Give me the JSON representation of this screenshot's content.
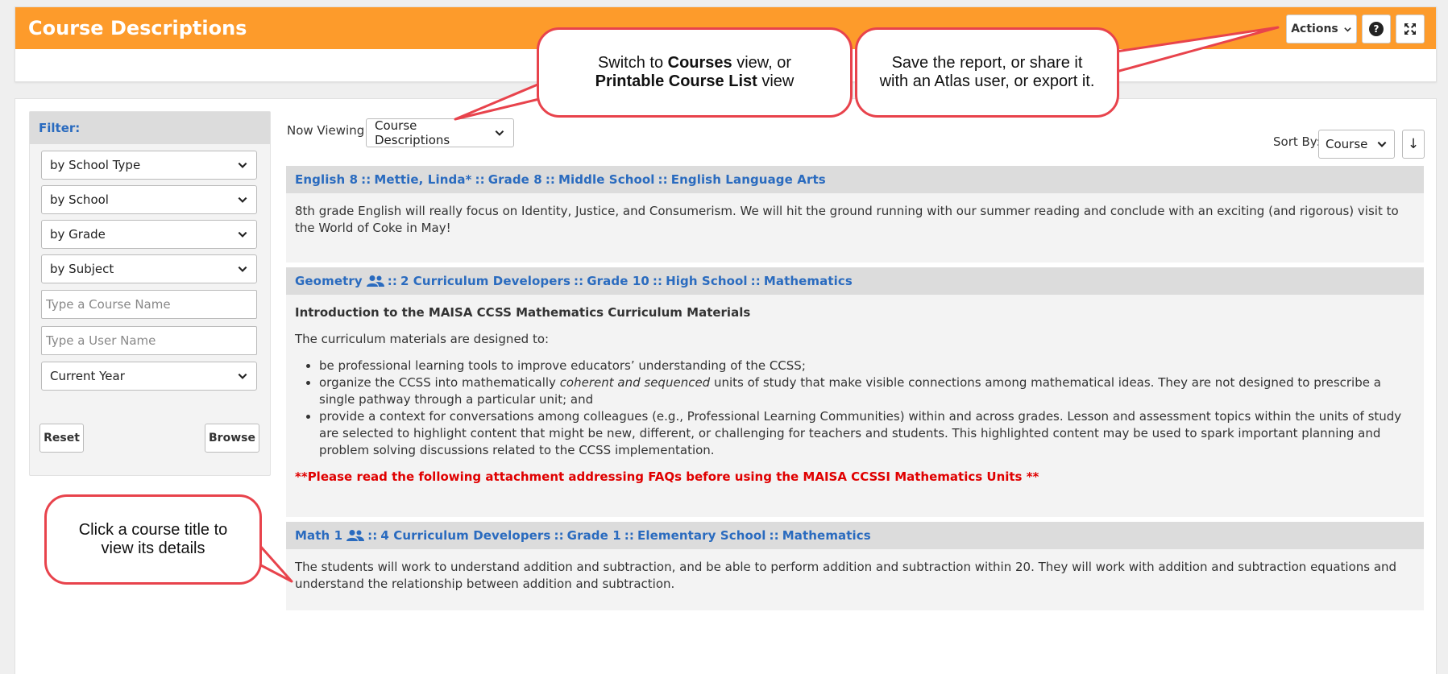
{
  "header": {
    "title": "Course Descriptions",
    "actions_label": "Actions",
    "help_icon": "question-circle-icon",
    "fullscreen_icon": "expand-icon",
    "brand_color": "#fd9b2b"
  },
  "filter": {
    "title": "Filter:",
    "school_type": "by School Type",
    "school": "by School",
    "grade": "by Grade",
    "subject": "by Subject",
    "course_placeholder": "Type a Course Name",
    "user_placeholder": "Type a User Name",
    "year": "Current Year",
    "reset_label": "Reset",
    "browse_label": "Browse"
  },
  "view": {
    "label": "Now Viewing:",
    "selected": "Course Descriptions",
    "sort_label": "Sort By:",
    "sort_selected": "Course",
    "sort_direction": "↓"
  },
  "courses": [
    {
      "title": "English 8",
      "parts": [
        "Mettie, Linda*",
        "Grade 8",
        "Middle School",
        "English Language Arts"
      ],
      "description": "8th grade English will really focus on Identity, Justice, and Consumerism. We will hit the ground running with our summer reading and conclude with an exciting (and rigorous) visit to the World of Coke in May!"
    },
    {
      "title": "Geometry",
      "parts": [
        "2 Curriculum Developers",
        "Grade 10",
        "High School",
        "Mathematics"
      ],
      "intro_heading": "Introduction to the MAISA CCSS Mathematics Curriculum Materials",
      "intro": "The curriculum materials are designed to:",
      "bullet1": "be professional learning tools to improve educators’ understanding of the CCSS;",
      "bullet2_pre": "organize the CCSS into mathematically ",
      "bullet2_em": "coherent and sequenced",
      "bullet2_post": " units of study that make visible connections among mathematical ideas. They are not designed to prescribe a single pathway through a particular unit; and",
      "bullet3": "provide a context for conversations among colleagues (e.g., Professional Learning Communities) within and across grades. Lesson and assessment topics within the units of study are selected to highlight content that might be new, different, or challenging for teachers and students. This highlighted content may be used to spark important planning and problem solving discussions related to the CCSS implementation.",
      "warning": "**Please read the following attachment addressing FAQs before using the MAISA CCSSI Mathematics Units **"
    },
    {
      "title": "Math 1",
      "parts": [
        "4 Curriculum Developers",
        "Grade 1",
        "Elementary School",
        "Mathematics"
      ],
      "description": "The students will work to understand addition and subtraction, and be able to perform addition and subtraction within 20. They will work with addition and subtraction equations and understand the relationship between addition and subtraction."
    }
  ],
  "separator": "::",
  "callouts": {
    "view_line1_pre": "Switch to ",
    "view_line1_bold": "Courses",
    "view_line1_post": " view, or",
    "view_line2_bold": "Printable Course List",
    "view_line2_post": " view",
    "actions_text": "Save the report, or share it with an Atlas user, or export it.",
    "course_text": "Click a course title to view its details"
  }
}
